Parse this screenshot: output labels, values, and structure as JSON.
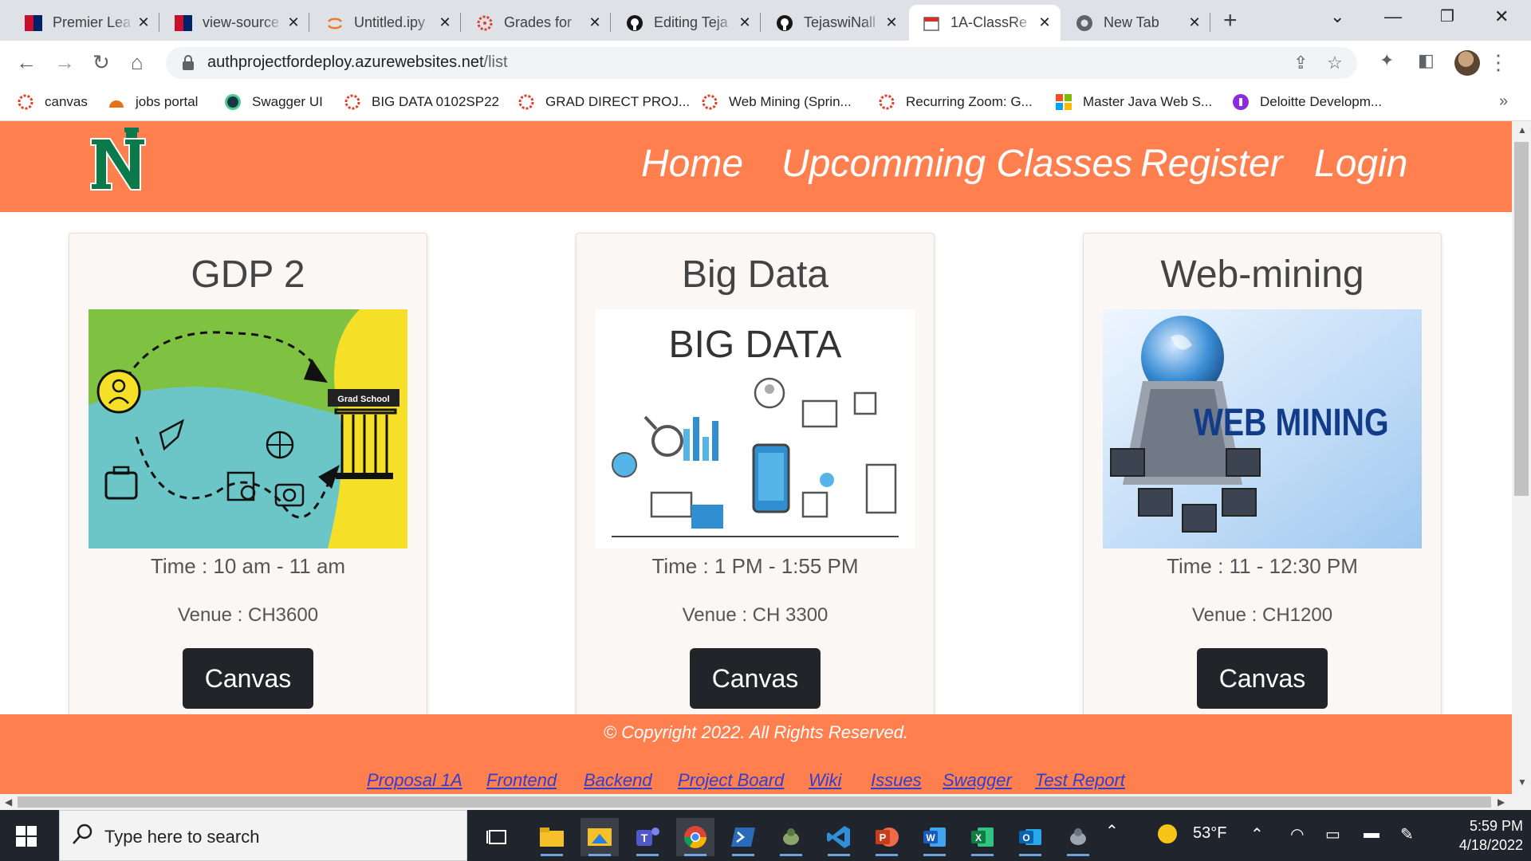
{
  "browser": {
    "tabs": [
      {
        "title": "Premier Lea",
        "icon": "premier-league-flag-icon"
      },
      {
        "title": "view-source",
        "icon": "flag-icon"
      },
      {
        "title": "Untitled.ipy",
        "icon": "jupyter-icon"
      },
      {
        "title": "Grades for",
        "icon": "canvas-icon"
      },
      {
        "title": "Editing Teja",
        "icon": "github-icon"
      },
      {
        "title": "TejaswiNall",
        "icon": "github-icon"
      },
      {
        "title": "1A-ClassRe",
        "icon": "calendar-icon",
        "active": true
      },
      {
        "title": "New Tab",
        "icon": "chrome-icon"
      }
    ],
    "url_host": "authprojectfordeploy.azurewebsites.net",
    "url_path": "/list",
    "bookmarks": [
      {
        "label": "canvas",
        "icon": "canvas-icon"
      },
      {
        "label": "jobs portal",
        "icon": "jobs-portal-icon"
      },
      {
        "label": "Swagger UI",
        "icon": "swagger-icon"
      },
      {
        "label": "BIG DATA 0102SP22",
        "icon": "canvas-icon"
      },
      {
        "label": "GRAD DIRECT PROJ...",
        "icon": "canvas-icon"
      },
      {
        "label": "Web Mining (Sprin...",
        "icon": "canvas-icon"
      },
      {
        "label": "Recurring Zoom: G...",
        "icon": "canvas-icon"
      },
      {
        "label": "Master Java Web S...",
        "icon": "microsoft-icon"
      },
      {
        "label": "Deloitte Developm...",
        "icon": "deloitte-icon"
      }
    ]
  },
  "site": {
    "nav": [
      "Home",
      "Upcomming Classes",
      "Register",
      "Login"
    ],
    "classes": [
      {
        "title": "GDP 2",
        "time": "Time : 10 am - 11 am",
        "venue": "Venue : CH3600",
        "button": "Canvas",
        "image_text": "Grad School"
      },
      {
        "title": "Big Data",
        "time": "Time : 1 PM - 1:55 PM",
        "venue": "Venue : CH 3300",
        "button": "Canvas",
        "image_text": "BIG DATA"
      },
      {
        "title": "Web-mining",
        "time": "Time : 11 - 12:30 PM",
        "venue": "Venue : CH1200",
        "button": "Canvas",
        "image_text": "WEB MINING"
      }
    ],
    "footer": {
      "copyright": "© Copyright 2022. All Rights Reserved.",
      "links": [
        "Proposal 1A",
        "Frontend",
        "Backend",
        "Project Board",
        "Wiki",
        "Issues",
        "Swagger",
        "Test Report"
      ]
    },
    "colors": {
      "header": "#ff7f4f",
      "button": "#212529",
      "link": "#2f3fcf",
      "logo": "#0b7a4b"
    }
  },
  "taskbar": {
    "search_placeholder": "Type here to search",
    "weather": "53°F",
    "time": "5:59 PM",
    "date": "4/18/2022",
    "apps": [
      "task-view-icon",
      "file-explorer-icon",
      "photos-icon",
      "teams-icon",
      "chrome-icon",
      "powershell-icon",
      "bug-tool-icon",
      "vscode-icon",
      "powerpoint-icon",
      "word-icon",
      "excel-icon",
      "outlook-icon",
      "bug-tool-icon"
    ]
  }
}
